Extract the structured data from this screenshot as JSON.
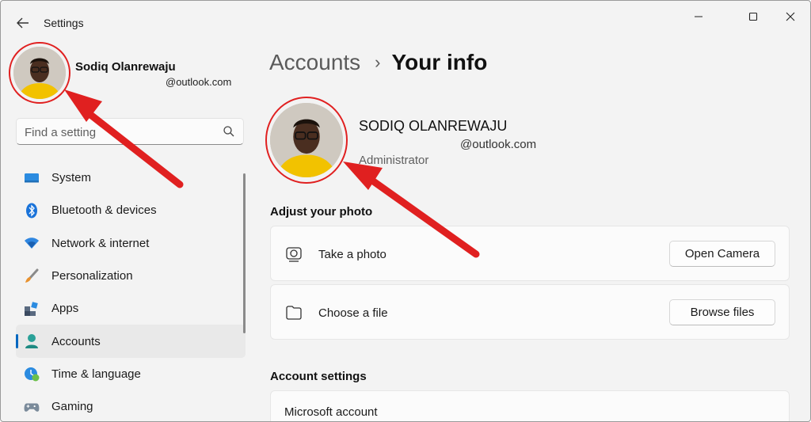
{
  "window": {
    "title": "Settings",
    "back_icon": "back-arrow-icon",
    "controls": [
      "minimize-icon",
      "maximize-icon",
      "close-icon"
    ]
  },
  "sidebar": {
    "profile": {
      "name": "Sodiq Olanrewaju",
      "email": "@outlook.com"
    },
    "search": {
      "placeholder": "Find a setting"
    },
    "items": [
      {
        "label": "System",
        "icon": "monitor-icon",
        "active": false
      },
      {
        "label": "Bluetooth & devices",
        "icon": "bluetooth-icon",
        "active": false
      },
      {
        "label": "Network & internet",
        "icon": "wifi-icon",
        "active": false
      },
      {
        "label": "Personalization",
        "icon": "paintbrush-icon",
        "active": false
      },
      {
        "label": "Apps",
        "icon": "apps-icon",
        "active": false
      },
      {
        "label": "Accounts",
        "icon": "person-icon",
        "active": true
      },
      {
        "label": "Time & language",
        "icon": "clock-globe-icon",
        "active": false
      },
      {
        "label": "Gaming",
        "icon": "gamepad-icon",
        "active": false
      }
    ]
  },
  "main": {
    "breadcrumb": {
      "parent": "Accounts",
      "separator": "›",
      "current": "Your info"
    },
    "user": {
      "name": "SODIQ OLANREWAJU",
      "email": "@outlook.com",
      "role": "Administrator"
    },
    "adjust_photo": {
      "title": "Adjust your photo",
      "take_photo": {
        "label": "Take a photo",
        "button": "Open Camera",
        "icon": "camera-icon"
      },
      "choose_file": {
        "label": "Choose a file",
        "button": "Browse files",
        "icon": "folder-icon"
      }
    },
    "account_settings": {
      "title": "Account settings",
      "microsoft_account": "Microsoft account"
    }
  },
  "colors": {
    "accent": "#0067c0",
    "annotation_red": "#e02020",
    "window_bg": "#f3f3f3",
    "card_bg": "#fbfbfb"
  }
}
